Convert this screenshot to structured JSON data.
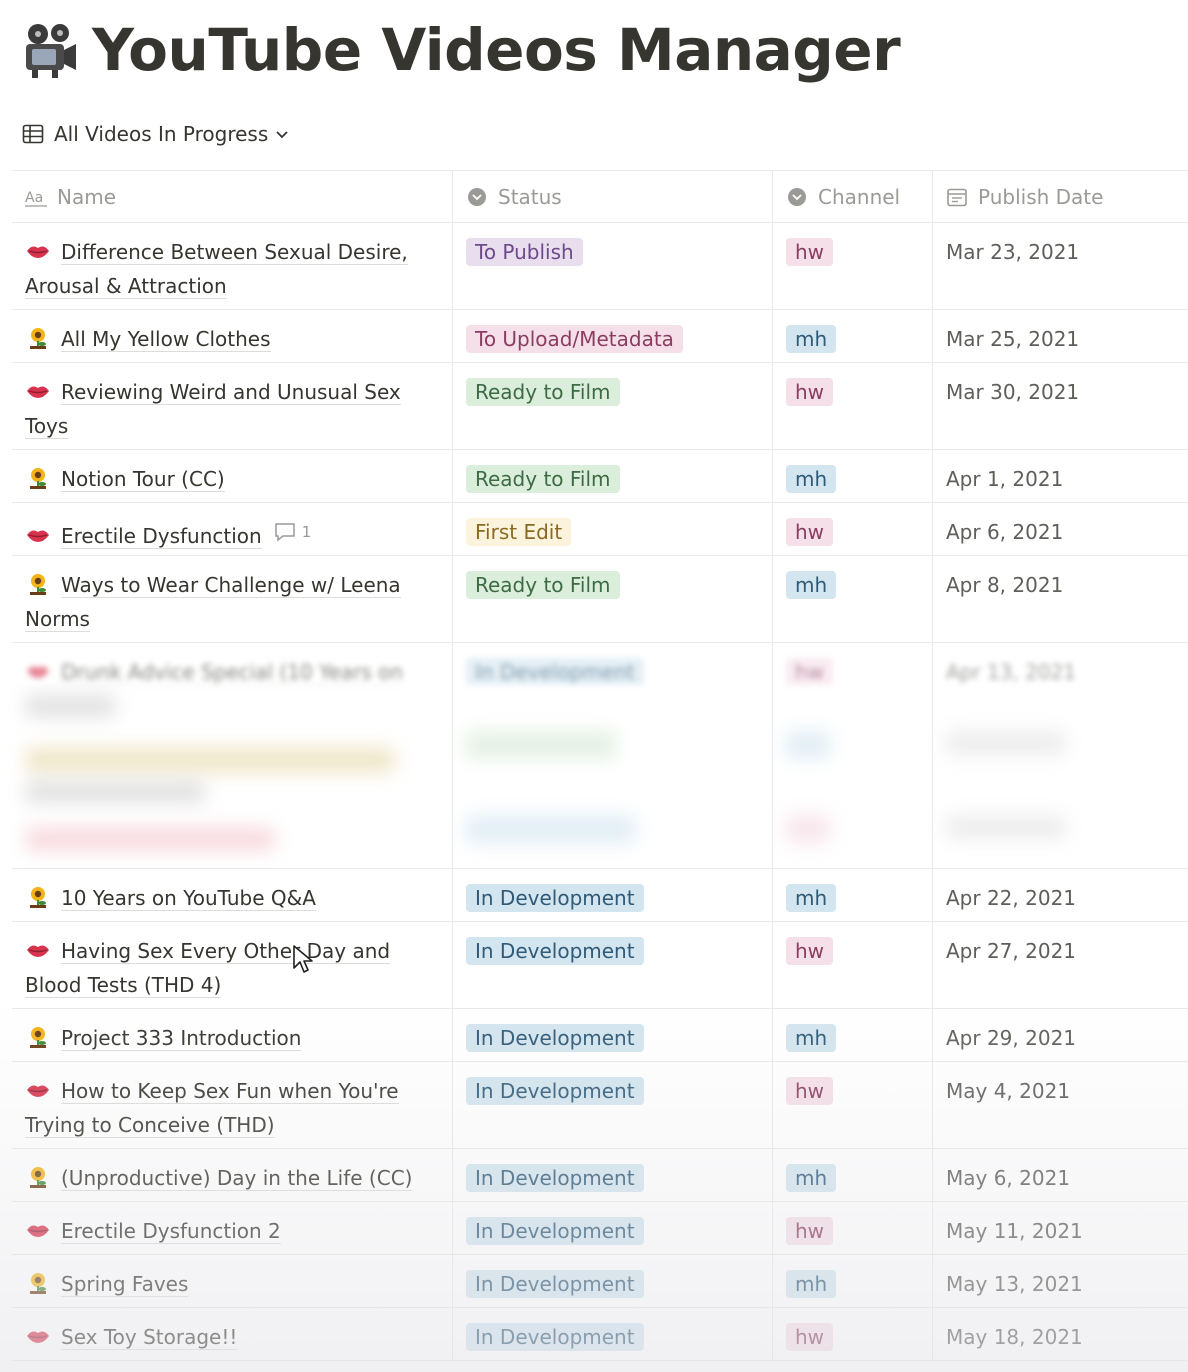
{
  "page": {
    "title": "YouTube Videos Manager",
    "icon": "film-projector-icon"
  },
  "view": {
    "label": "All Videos In Progress"
  },
  "columns": {
    "name": "Name",
    "status": "Status",
    "channel": "Channel",
    "publish_date": "Publish Date"
  },
  "colors": {
    "status_to_publish": "#e8deee",
    "status_to_upload": "#f5e0e9",
    "status_ready_to_film": "#dbeddb",
    "status_first_edit": "#fbf3db",
    "status_in_development": "#d3e5ef",
    "channel_hw": "#f5e0e9",
    "channel_mh": "#d3e5ef"
  },
  "rows": [
    {
      "icon": "lips-icon",
      "name": "Difference Between Sexual Desire, Arousal & Attraction",
      "status": "To Publish",
      "channel": "hw",
      "date": "Mar 23, 2021"
    },
    {
      "icon": "sunflower-icon",
      "name": "All My Yellow Clothes",
      "status": "To Upload/Metadata",
      "channel": "mh",
      "date": "Mar 25, 2021"
    },
    {
      "icon": "lips-icon",
      "name": "Reviewing Weird and Unusual Sex Toys",
      "status": "Ready to Film",
      "channel": "hw",
      "date": "Mar 30, 2021"
    },
    {
      "icon": "sunflower-icon",
      "name": "Notion Tour (CC)",
      "status": "Ready to Film",
      "channel": "mh",
      "date": "Apr 1, 2021"
    },
    {
      "icon": "lips-icon",
      "name": "Erectile Dysfunction",
      "comments": "1",
      "status": "First Edit",
      "channel": "hw",
      "date": "Apr 6, 2021"
    },
    {
      "icon": "sunflower-icon",
      "name": "Ways to Wear Challenge w/ Leena Norms",
      "status": "Ready to Film",
      "channel": "mh",
      "date": "Apr 8, 2021"
    },
    {
      "icon": "lips-icon",
      "name": "Drunk Advice Special (10 Years on",
      "status": "In Development",
      "channel": "hw",
      "date": "Apr 13, 2021"
    },
    {
      "icon": "sunflower-icon",
      "name": "10 Years on YouTube Q&A",
      "status": "In Development",
      "channel": "mh",
      "date": "Apr 22, 2021"
    },
    {
      "icon": "lips-icon",
      "name": "Having Sex Every Other Day and Blood Tests (THD 4)",
      "status": "In Development",
      "channel": "hw",
      "date": "Apr 27, 2021"
    },
    {
      "icon": "sunflower-icon",
      "name": "Project 333 Introduction",
      "status": "In Development",
      "channel": "mh",
      "date": "Apr 29, 2021"
    },
    {
      "icon": "lips-icon",
      "name": "How to Keep Sex Fun when You're Trying to Conceive (THD)",
      "status": "In Development",
      "channel": "hw",
      "date": "May 4, 2021"
    },
    {
      "icon": "sunflower-icon",
      "name": "(Unproductive) Day in the Life (CC)",
      "status": "In Development",
      "channel": "mh",
      "date": "May 6, 2021"
    },
    {
      "icon": "lips-icon",
      "name": "Erectile Dysfunction 2",
      "status": "In Development",
      "channel": "hw",
      "date": "May 11, 2021"
    },
    {
      "icon": "sunflower-icon",
      "name": "Spring Faves",
      "status": "In Development",
      "channel": "mh",
      "date": "May 13, 2021"
    },
    {
      "icon": "lips-icon",
      "name": "Sex Toy Storage!!",
      "status": "In Development",
      "channel": "hw",
      "date": "May 18, 2021"
    }
  ]
}
